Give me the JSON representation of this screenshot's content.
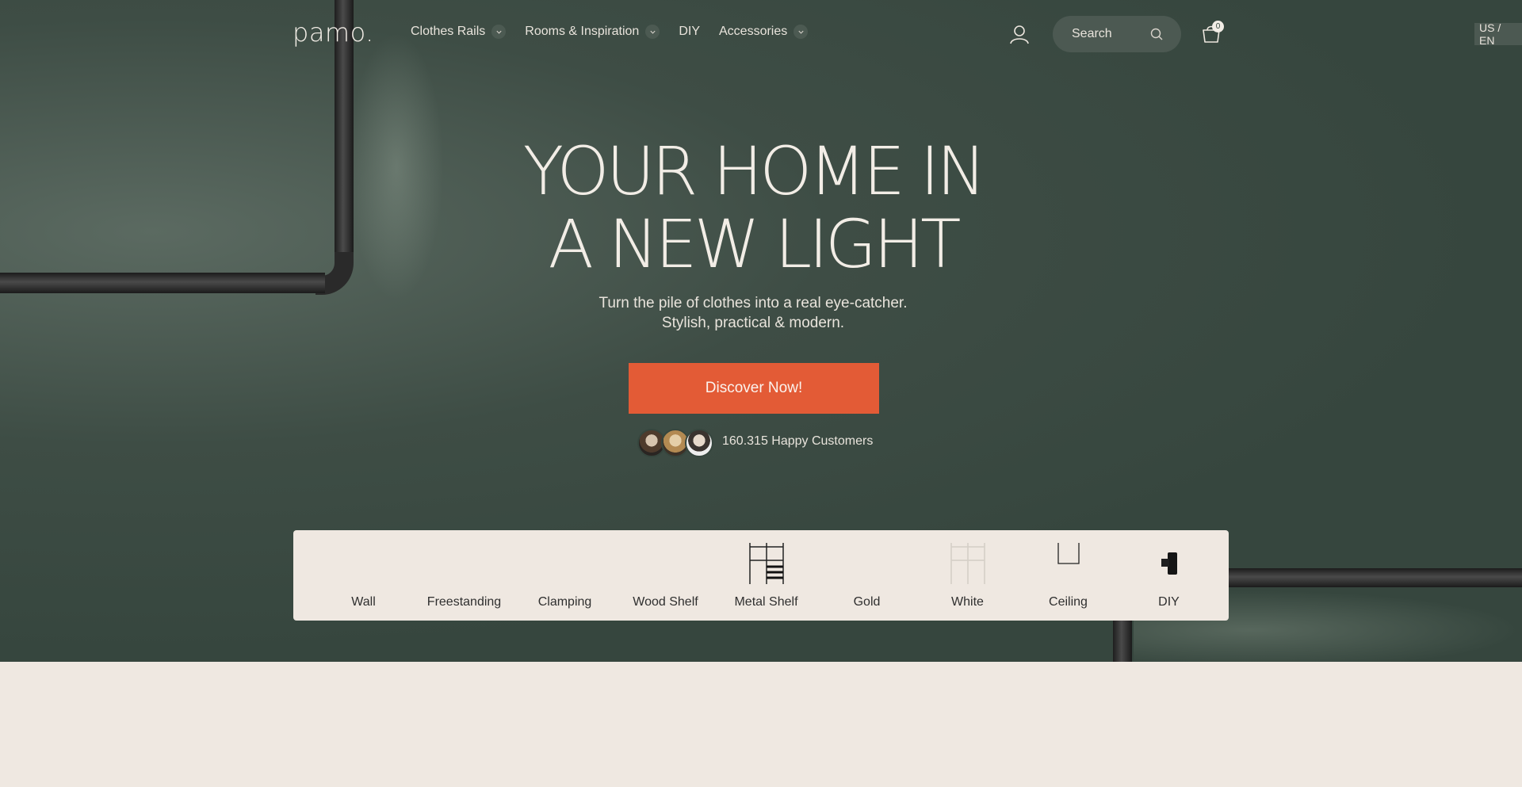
{
  "header": {
    "logo": "pamo.",
    "nav": [
      {
        "label": "Clothes Rails",
        "has_dropdown": true
      },
      {
        "label": "Rooms & Inspiration",
        "has_dropdown": true
      },
      {
        "label": "DIY",
        "has_dropdown": false
      },
      {
        "label": "Accessories",
        "has_dropdown": true
      }
    ],
    "search_placeholder": "Search",
    "cart_count": "0",
    "locale": "US / EN"
  },
  "hero": {
    "headline_line1": "YOUR HOME IN",
    "headline_line2": "A NEW LIGHT",
    "sub_line1": "Turn the pile of clothes into a real eye-catcher.",
    "sub_line2": "Stylish, practical & modern.",
    "cta": "Discover Now!",
    "customers": "160.315 Happy Customers"
  },
  "categories": [
    {
      "label": "Wall",
      "icon": "none"
    },
    {
      "label": "Freestanding",
      "icon": "none"
    },
    {
      "label": "Clamping",
      "icon": "none"
    },
    {
      "label": "Wood Shelf",
      "icon": "none"
    },
    {
      "label": "Metal Shelf",
      "icon": "metal-shelf-icon"
    },
    {
      "label": "Gold",
      "icon": "none"
    },
    {
      "label": "White",
      "icon": "white-rack-icon"
    },
    {
      "label": "Ceiling",
      "icon": "ceiling-rail-icon"
    },
    {
      "label": "DIY",
      "icon": "diy-connector-icon"
    }
  ],
  "colors": {
    "hero_bg": "#36463e",
    "accent": "#e35b36",
    "cream": "#efe8e1"
  }
}
